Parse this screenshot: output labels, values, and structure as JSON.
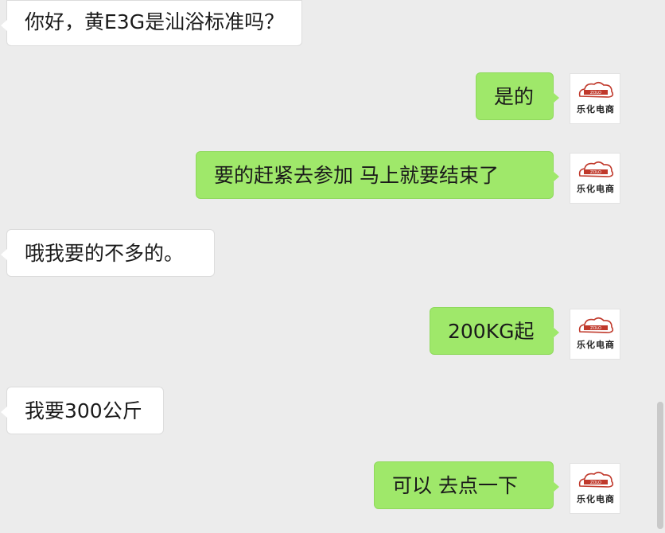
{
  "messages": [
    {
      "side": "in",
      "text": "你好，黄E3G是汕浴标准吗？"
    },
    {
      "side": "out",
      "text": "是的"
    },
    {
      "side": "out",
      "text": "要的赶紧去参加  马上就要结束了"
    },
    {
      "side": "in",
      "text": "哦我要的不多的。"
    },
    {
      "side": "out",
      "text": "200KG起"
    },
    {
      "side": "in",
      "text": "我要300公斤"
    },
    {
      "side": "out",
      "text": "可以  去点一下"
    }
  ],
  "avatar": {
    "caption": "乐化电商",
    "logo_text": "ZOLO",
    "icon": "shop-logo-icon"
  },
  "colors": {
    "background": "#ececec",
    "incoming_bubble": "#ffffff",
    "outgoing_bubble": "#9fe86a"
  }
}
